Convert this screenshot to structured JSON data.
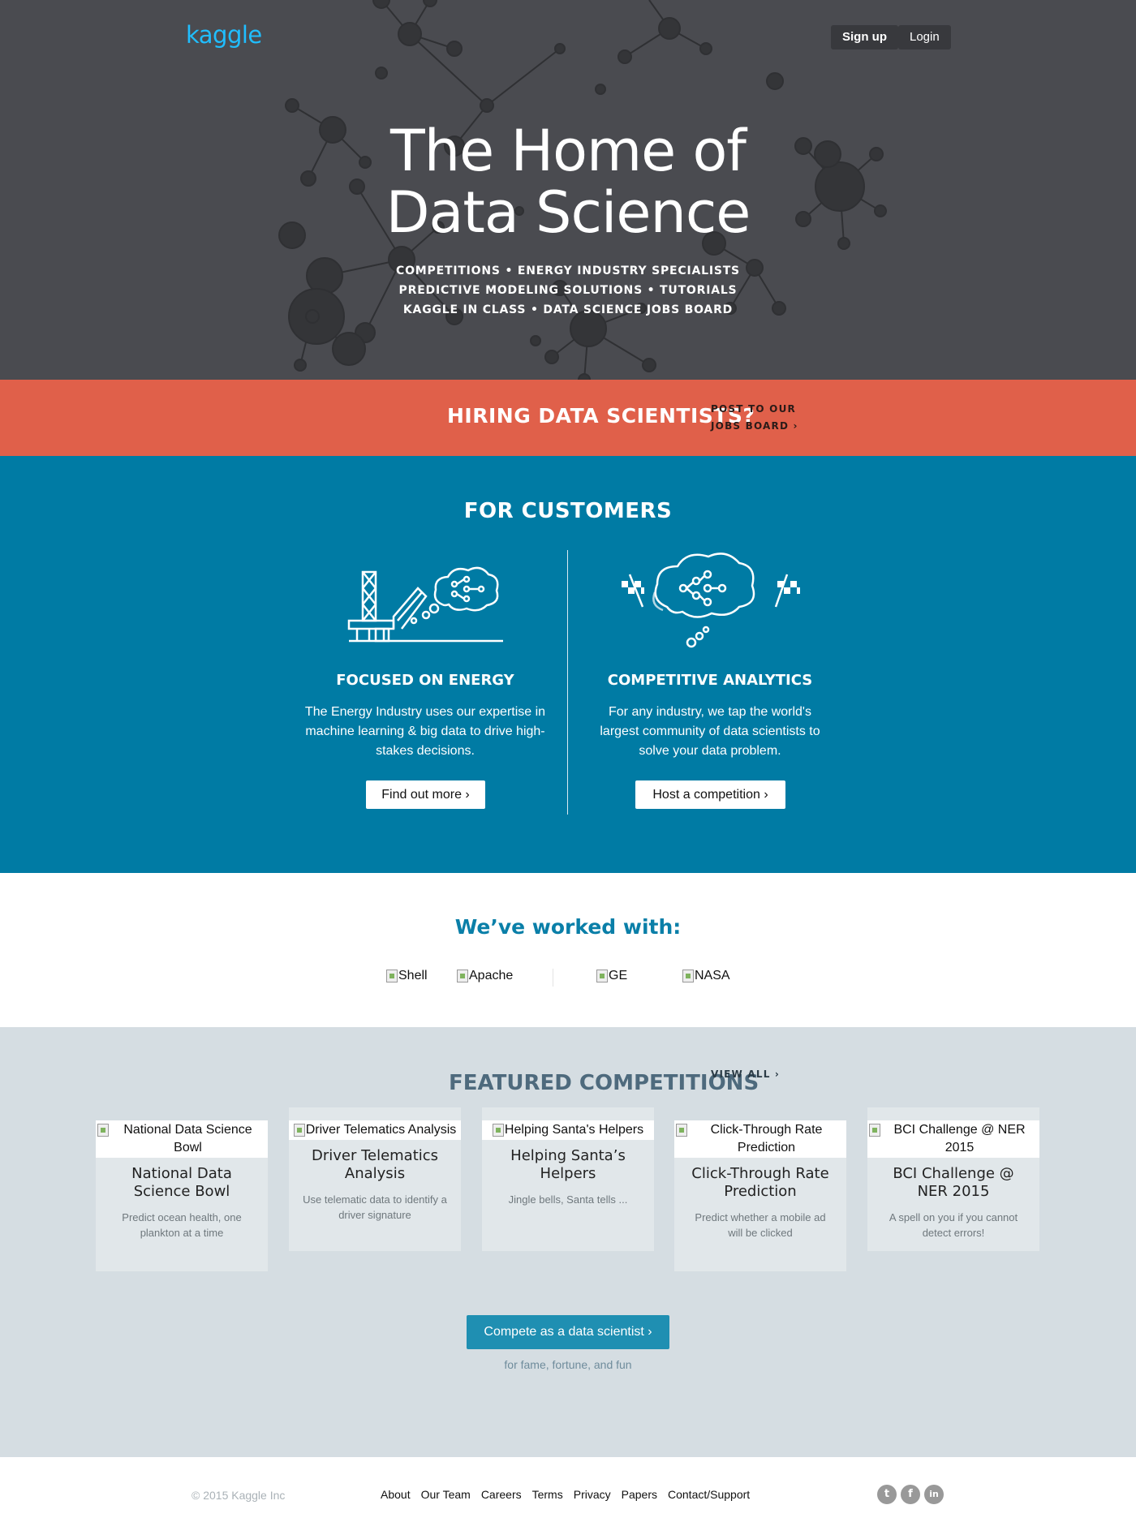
{
  "header": {
    "logo": "kaggle",
    "signup_label": "Sign up",
    "login_label": "Login"
  },
  "hero": {
    "title_line1": "The Home of",
    "title_line2": "Data Science",
    "links_line1": "COMPETITIONS • ENERGY INDUSTRY SPECIALISTS",
    "links_line2": "PREDICTIVE MODELING SOLUTIONS • TUTORIALS",
    "links_line3": "KAGGLE IN CLASS • DATA SCIENCE JOBS BOARD"
  },
  "hiring": {
    "title": "HIRING DATA SCIENTISTS?",
    "link_line1": "POST TO OUR",
    "link_line2": "JOBS BOARD ›"
  },
  "customers": {
    "title": "FOR CUSTOMERS",
    "energy": {
      "heading": "FOCUSED ON ENERGY",
      "text": "The Energy Industry uses our expertise in machine learning & big data to drive high-stakes decisions.",
      "button": "Find out more ›",
      "icon": "oil-rig-thought-icon"
    },
    "analytics": {
      "heading": "COMPETITIVE ANALYTICS",
      "text": "For any industry, we tap the world's largest community of data scientists to solve your data problem.",
      "button": "Host a competition ›",
      "icon": "brain-flags-icon"
    }
  },
  "worked_with": {
    "title": "We’ve worked with:",
    "partners": [
      "Shell",
      "Apache",
      "GE",
      "NASA"
    ]
  },
  "featured": {
    "title": "FEATURED COMPETITIONS",
    "view_all": "VIEW ALL ›",
    "cards": [
      {
        "img_alt": "National Data Science Bowl",
        "title": "National Data Science Bowl",
        "desc": "Predict ocean health, one plankton at a time"
      },
      {
        "img_alt": "Driver Telematics Analysis",
        "title": "Driver Telematics Analysis",
        "desc": "Use telematic data to identify a driver signature"
      },
      {
        "img_alt": "Helping Santa's Helpers",
        "title": "Helping Santa’s Helpers",
        "desc": "Jingle bells, Santa tells ..."
      },
      {
        "img_alt": "Click-Through Rate Prediction",
        "title": "Click-Through Rate Prediction",
        "desc": "Predict whether a mobile ad will be clicked"
      },
      {
        "img_alt": "BCI Challenge @ NER 2015",
        "title": "BCI Challenge @ NER 2015",
        "desc": "A spell on you if you cannot detect errors!"
      }
    ],
    "cta": "Compete as a data scientist ›",
    "cta_sub": "for fame, fortune, and fun"
  },
  "footer": {
    "copyright": "© 2015 Kaggle Inc",
    "links": [
      "About",
      "Our Team",
      "Careers",
      "Terms",
      "Privacy",
      "Papers",
      "Contact/Support"
    ],
    "social": [
      {
        "icon": "twitter-icon",
        "glyph": "t"
      },
      {
        "icon": "facebook-icon",
        "glyph": "f"
      },
      {
        "icon": "linkedin-icon",
        "glyph": "in"
      }
    ]
  },
  "colors": {
    "hero_bg": "#4a4b50",
    "hiring_bg": "#e0604a",
    "customers_bg": "#007ba4",
    "featured_bg": "#d5dde2",
    "brand": "#20beff",
    "cta_bg": "#1f8fb2"
  }
}
